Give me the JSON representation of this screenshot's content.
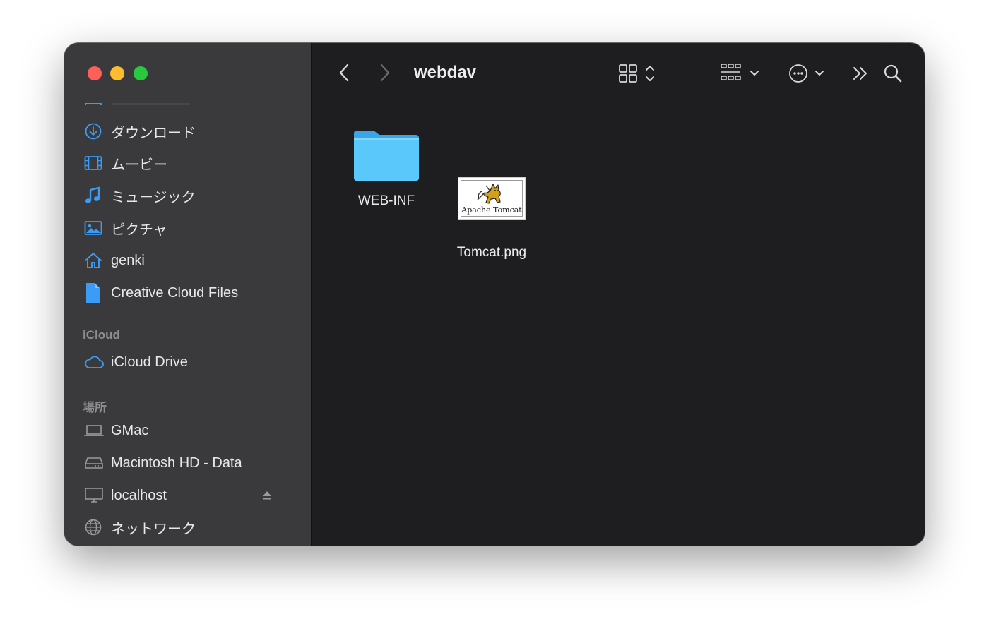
{
  "window": {
    "title": "webdav"
  },
  "sidebar": {
    "favorites": [
      {
        "label": "ダウンロード",
        "icon": "download-icon"
      },
      {
        "label": "ムービー",
        "icon": "film-icon"
      },
      {
        "label": "ミュージック",
        "icon": "music-note-icon"
      },
      {
        "label": "ピクチャ",
        "icon": "photo-icon"
      },
      {
        "label": "genki",
        "icon": "home-icon"
      },
      {
        "label": "Creative Cloud Files",
        "icon": "document-icon"
      }
    ],
    "icloud_header": "iCloud",
    "icloud": [
      {
        "label": "iCloud Drive",
        "icon": "cloud-icon"
      }
    ],
    "locations_header": "場所",
    "locations": [
      {
        "label": "GMac",
        "icon": "laptop-icon"
      },
      {
        "label": "Macintosh HD - Data",
        "icon": "drive-icon"
      },
      {
        "label": "localhost",
        "icon": "display-icon"
      },
      {
        "label": "ネットワーク",
        "icon": "globe-icon"
      }
    ]
  },
  "files": [
    {
      "name": "WEB-INF",
      "kind": "folder",
      "icon": "folder-icon"
    },
    {
      "name": "Tomcat.png",
      "kind": "image",
      "icon": "tomcat-thumbnail",
      "thumbnail_text": "Apache Tomcat"
    }
  ],
  "colors": {
    "accent": "#3b9cf7",
    "folder": "#5ac8fa",
    "sidebar": "#3a3a3c",
    "content": "#1e1e20"
  }
}
